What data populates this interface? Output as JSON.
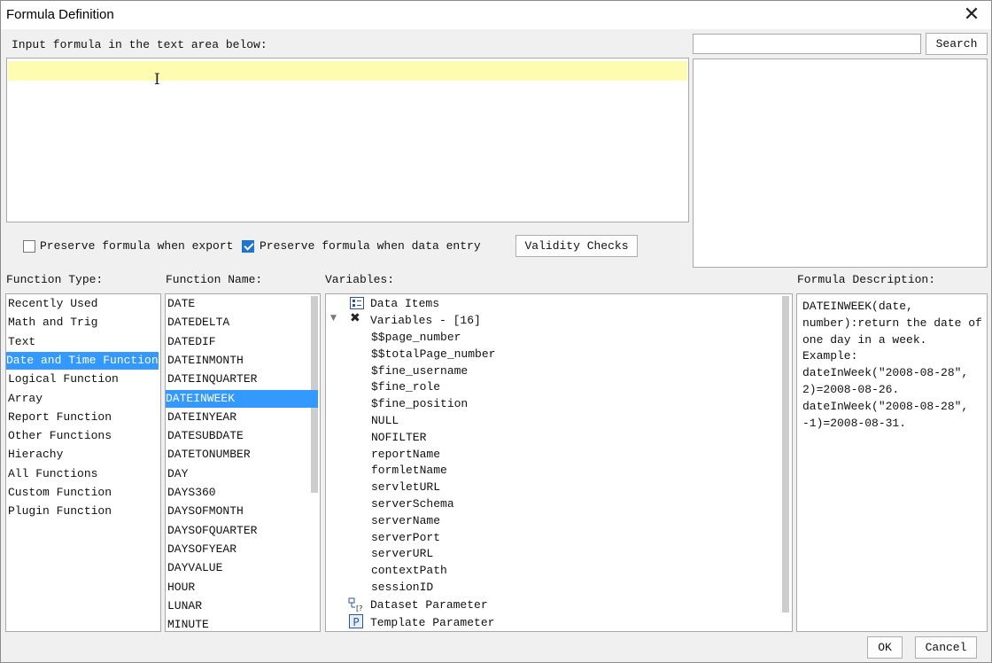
{
  "window": {
    "title": "Formula Definition"
  },
  "editor": {
    "label": "Input formula in the text area below:",
    "value": ""
  },
  "search": {
    "placeholder": "",
    "button": "Search"
  },
  "options": {
    "preserve_export": {
      "label": "Preserve formula when export",
      "checked": false
    },
    "preserve_entry": {
      "label": "Preserve formula when data entry",
      "checked": true
    },
    "validity_button": "Validity Checks"
  },
  "function_type": {
    "label": "Function Type:",
    "selected": "Date and Time Function",
    "items": [
      "Recently Used",
      "Math and Trig",
      "Text",
      "Date and Time Function",
      "Logical Function",
      "Array",
      "Report Function",
      "Other Functions",
      "Hierachy",
      "All Functions",
      "Custom Function",
      "Plugin Function"
    ]
  },
  "function_name": {
    "label": "Function Name:",
    "selected": "DATEINWEEK",
    "items": [
      "DATE",
      "DATEDELTA",
      "DATEDIF",
      "DATEINMONTH",
      "DATEINQUARTER",
      "DATEINWEEK",
      "DATEINYEAR",
      "DATESUBDATE",
      "DATETONUMBER",
      "DAY",
      "DAYS360",
      "DAYSOFMONTH",
      "DAYSOFQUARTER",
      "DAYSOFYEAR",
      "DAYVALUE",
      "HOUR",
      "LUNAR",
      "MINUTE"
    ]
  },
  "variables": {
    "label": "Variables:",
    "data_items": "Data Items",
    "group": "Variables - [16]",
    "items": [
      "$$page_number",
      "$$totalPage_number",
      "$fine_username",
      "$fine_role",
      "$fine_position",
      "NULL",
      "NOFILTER",
      "reportName",
      "formletName",
      "servletURL",
      "serverSchema",
      "serverName",
      "serverPort",
      "serverURL",
      "contextPath",
      "sessionID"
    ],
    "dataset_param": "Dataset Parameter",
    "template_param": "Template Parameter"
  },
  "description": {
    "label": "Formula Description:",
    "lines": [
      "DATEINWEEK(date,",
      "number):return the date of",
      "one day in a week.",
      "Example:",
      "dateInWeek(\"2008-08-28\",",
      "2)=2008-08-26.",
      "dateInWeek(\"2008-08-28\",",
      "-1)=2008-08-31."
    ]
  },
  "footer": {
    "ok": "OK",
    "cancel": "Cancel"
  },
  "colors": {
    "selection": "#3399ff",
    "editor_highlight": "#fdfcb1",
    "checkbox_checked": "#1b74d6"
  },
  "icons": {
    "close": "close-icon",
    "data_items": "list-card-icon",
    "variables": "variables-icon",
    "dataset": "dataset-icon",
    "template": "parameter-icon"
  }
}
